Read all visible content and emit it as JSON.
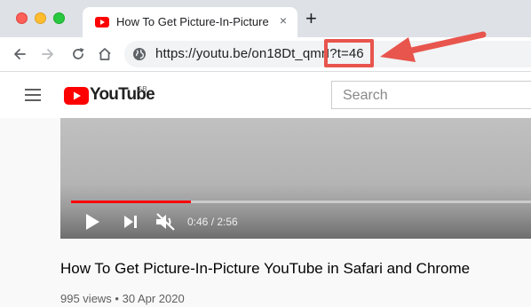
{
  "browser": {
    "tab": {
      "title": "How To Get Picture-In-Picture",
      "close_label": "×"
    },
    "new_tab_label": "+",
    "address_bar": {
      "url": "https://youtu.be/on18Dt_qmrI?t=46"
    },
    "annotation": {
      "color": "#e8554d"
    }
  },
  "youtube": {
    "logo_text": "YouTube",
    "region": "GB",
    "search_placeholder": "Search",
    "player": {
      "current_time": "0:46",
      "duration": "2:56",
      "time_separator": " / ",
      "progress_fraction": 0.261
    },
    "video": {
      "title": "How To Get Picture-In-Picture YouTube in Safari and Chrome",
      "views": "995 views",
      "separator": " • ",
      "date": "30 Apr 2020"
    }
  },
  "colors": {
    "youtube_red": "#ff0000",
    "tab_strip": "#dee1e6"
  }
}
